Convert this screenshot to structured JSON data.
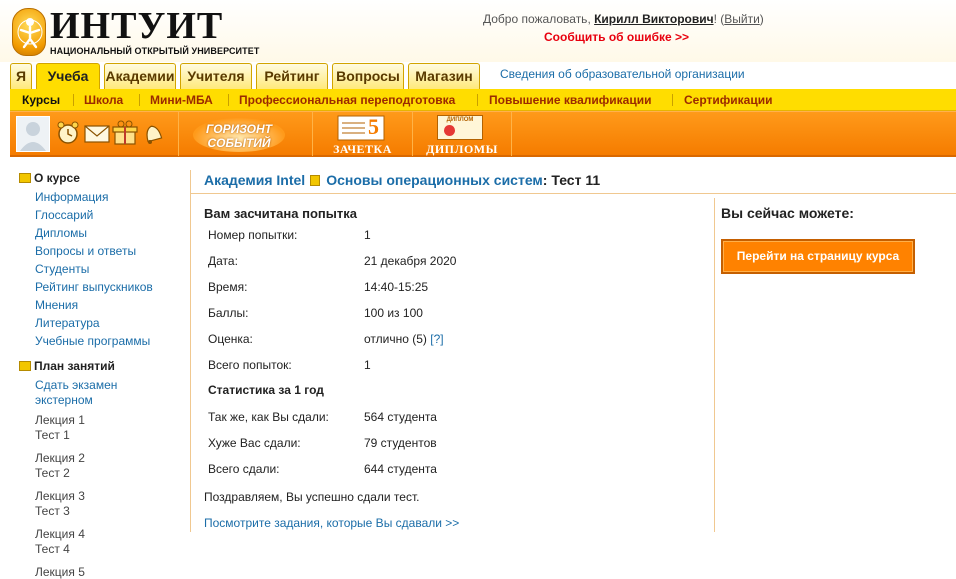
{
  "header": {
    "logo_word": "ИНТУИТ",
    "logo_sub": "НАЦИОНАЛЬНЫЙ ОТКРЫТЫЙ УНИВЕРСИТЕТ",
    "welcome_prefix": "Добро пожаловать, ",
    "user_name": "Кирилл Викторович",
    "welcome_bang": "! (",
    "logout": "Выйти",
    "welcome_close": ")",
    "report_error": "Сообщить об ошибке >>"
  },
  "tabs": [
    {
      "label": "Я"
    },
    {
      "label": "Учеба",
      "active": true
    },
    {
      "label": "Академии"
    },
    {
      "label": "Учителя"
    },
    {
      "label": "Рейтинг"
    },
    {
      "label": "Вопросы"
    },
    {
      "label": "Магазин"
    }
  ],
  "org_link": "Сведения об образовательной организации",
  "subnav": [
    {
      "label": "Курсы",
      "active": true
    },
    {
      "label": "Школа"
    },
    {
      "label": "Мини-МБА"
    },
    {
      "label": "Профессиональная переподготовка"
    },
    {
      "label": "Повышение квалификации"
    },
    {
      "label": "Сертификации"
    }
  ],
  "toolbar": {
    "icons": [
      "alarm-clock-icon",
      "envelope-icon",
      "gift-icon",
      "bell-icon"
    ],
    "gorizont_line1": "ГОРИЗОНТ",
    "gorizont_line2": "СОБЫТИЙ",
    "zachetka_number": "5",
    "zachetka": "ЗАЧЕТКА",
    "diploma_badge": "ДИПЛОМ",
    "diplomy": "ДИПЛОМЫ"
  },
  "sidebar": {
    "about_title": "О курсе",
    "about_links": [
      "Информация",
      "Глоссарий",
      "Дипломы",
      "Вопросы и ответы",
      "Студенты",
      "Рейтинг выпускников",
      "Мнения",
      "Литература",
      "Учебные программы"
    ],
    "plan_title": "План занятий",
    "exam_line1": "Сдать экзамен",
    "exam_line2": "экстерном",
    "lectures": [
      {
        "lecture": "Лекция 1",
        "test": "Тест 1"
      },
      {
        "lecture": "Лекция 2",
        "test": "Тест 2"
      },
      {
        "lecture": "Лекция 3",
        "test": "Тест 3"
      },
      {
        "lecture": "Лекция 4",
        "test": "Тест 4"
      },
      {
        "lecture": "Лекция 5",
        "test": ""
      }
    ]
  },
  "breadcrumb": {
    "academy": "Академия Intel",
    "course": "Основы операционных систем",
    "test": ": Тест 11"
  },
  "result": {
    "title": "Вам засчитана попытка",
    "rows": [
      {
        "label": "Номер попытки:",
        "value": "1"
      },
      {
        "label": "Дата:",
        "value": "21 декабря 2020"
      },
      {
        "label": "Время:",
        "value": "14:40-15:25"
      },
      {
        "label": "Баллы:",
        "value": "100 из 100"
      },
      {
        "label": "Оценка:",
        "value": "отлично (5)",
        "help": "[?]"
      },
      {
        "label": "Всего попыток:",
        "value": "1"
      }
    ],
    "stats_title": "Статистика за 1 год",
    "stats": [
      {
        "label": "Так же, как Вы сдали:",
        "value": "564 студента"
      },
      {
        "label": "Хуже Вас сдали:",
        "value": "79 студентов"
      },
      {
        "label": "Всего сдали:",
        "value": "644 студента"
      }
    ],
    "congrats": "Поздравляем, Вы успешно сдали тест.",
    "tasks_link": "Посмотрите задания, которые Вы сдавали >>"
  },
  "actions": {
    "title": "Вы сейчас можете:",
    "course_button": "Перейти на страницу курса"
  }
}
